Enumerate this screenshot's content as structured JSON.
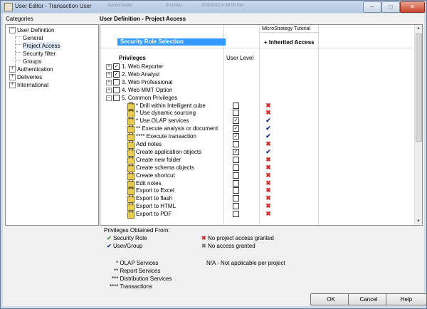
{
  "window": {
    "title": "User Editor - Transaction User",
    "ghost_texts": [
      "Administrator",
      "Enabled",
      "2/26/2012 4:38:50 PM"
    ],
    "minimize_glyph": "–",
    "maximize_glyph": "□",
    "close_glyph": "✕"
  },
  "categories": {
    "header": "Categories",
    "items": [
      {
        "label": "User Definition",
        "level": 0,
        "expander": "−"
      },
      {
        "label": "General",
        "level": 1
      },
      {
        "label": "Project Access",
        "level": 1,
        "selected": true
      },
      {
        "label": "Security filter",
        "level": 1
      },
      {
        "label": "Groups",
        "level": 1
      },
      {
        "label": "Authentication",
        "level": 0,
        "expander": "+"
      },
      {
        "label": "Deliveries",
        "level": 0,
        "expander": "+"
      },
      {
        "label": "International",
        "level": 0,
        "expander": "+"
      }
    ]
  },
  "project_access": {
    "section_title": "User Definition - Project Access",
    "project_column": "MicroStrategy Tutorial",
    "security_role_selection": "Security Role Selection",
    "inherited_access": "+ Inherited Access",
    "privileges_header": "Privileges",
    "user_level_header": "User Level",
    "rows": [
      {
        "label": "1. Web Reporter",
        "type": "group",
        "expander": "+",
        "checked": true,
        "mark": ""
      },
      {
        "label": "2. Web Analyst",
        "type": "group",
        "expander": "+",
        "checked": true,
        "mark": ""
      },
      {
        "label": "3. Web Professional",
        "type": "group",
        "expander": "+",
        "checked": false,
        "mark": ""
      },
      {
        "label": "4. Web MMT Option",
        "type": "group",
        "expander": "+",
        "checked": false,
        "mark": ""
      },
      {
        "label": "5. Common Privileges",
        "type": "group",
        "expander": "−",
        "checked": false,
        "mark": ""
      },
      {
        "label": "* Drill within Intelligent cube",
        "type": "item",
        "checked": false,
        "mark": "x"
      },
      {
        "label": "* Use dynamic sourcing",
        "type": "item",
        "checked": false,
        "mark": "x"
      },
      {
        "label": "* Use OLAP services",
        "type": "item",
        "checked": true,
        "mark": "ok"
      },
      {
        "label": "** Execute analysis or document",
        "type": "item",
        "checked": true,
        "mark": "ok"
      },
      {
        "label": "**** Execute transaction",
        "type": "item",
        "checked": true,
        "mark": "ok"
      },
      {
        "label": "Add notes",
        "type": "item",
        "checked": false,
        "mark": "x"
      },
      {
        "label": "Create application objects",
        "type": "item",
        "checked": true,
        "mark": "ok"
      },
      {
        "label": "Create new folder",
        "type": "item",
        "checked": false,
        "mark": "x"
      },
      {
        "label": "Create schema objects",
        "type": "item",
        "checked": false,
        "mark": "x"
      },
      {
        "label": "Create shortcut",
        "type": "item",
        "checked": false,
        "mark": "x"
      },
      {
        "label": "Edit notes",
        "type": "item",
        "checked": false,
        "mark": "x"
      },
      {
        "label": "Export to Excel",
        "type": "item",
        "checked": false,
        "mark": "x"
      },
      {
        "label": "Export to flash",
        "type": "item",
        "checked": false,
        "mark": "x"
      },
      {
        "label": "Export to HTML",
        "type": "item",
        "checked": false,
        "mark": "x"
      },
      {
        "label": "Export to PDF",
        "type": "item",
        "checked": false,
        "mark": "x"
      }
    ]
  },
  "legend": {
    "title": "Privileges Obtained From:",
    "security_role": "Security Role",
    "user_group": "User/Group",
    "no_project_access": "No project access granted",
    "no_access": "No access granted",
    "na": "N/A - Not applicable per project",
    "olap": "* OLAP Services",
    "report": "** Report Services",
    "distribution": "*** Distribution Services",
    "transactions": "**** Transactions"
  },
  "buttons": {
    "ok": "OK",
    "cancel": "Cancel",
    "help": "Help"
  },
  "colors": {
    "selection": "#3399ff",
    "deny": "#d12b2b",
    "grant": "#1a2f8a",
    "security_role": "#2b9b2b"
  }
}
